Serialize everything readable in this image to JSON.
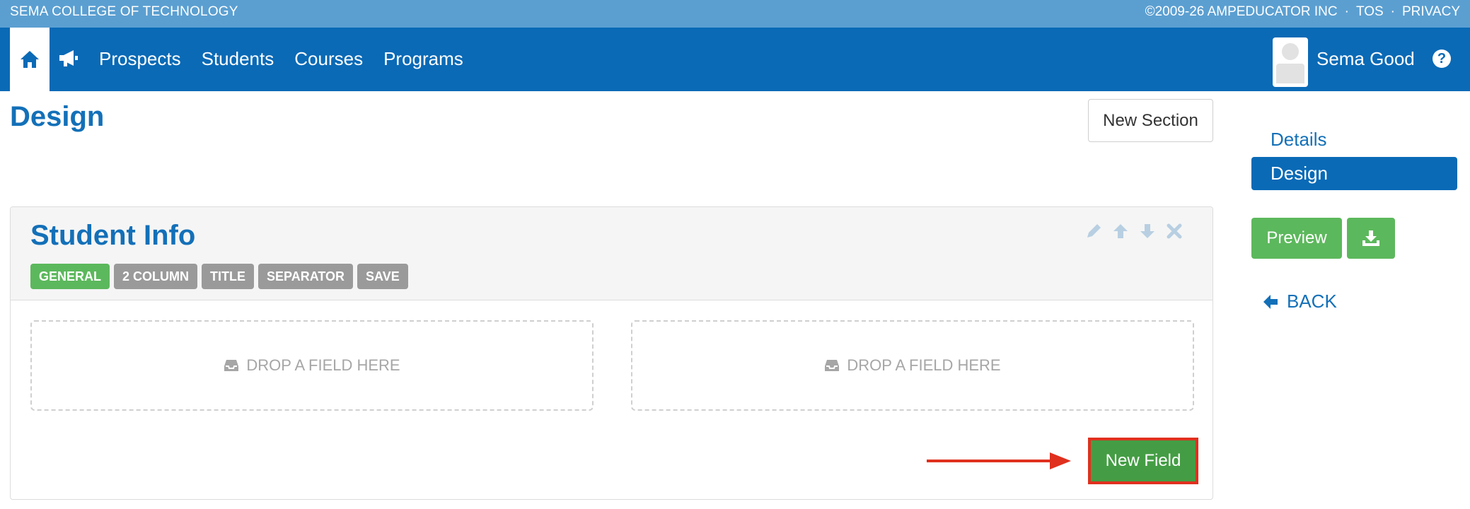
{
  "topstrip": {
    "school": "SEMA COLLEGE OF TECHNOLOGY",
    "copyright": "©2009-26 AMPEDUCATOR INC",
    "tos": "TOS",
    "privacy": "PRIVACY",
    "separator": "·"
  },
  "nav": {
    "home_icon": "home-icon",
    "announce_icon": "megaphone-icon",
    "links": [
      "Prospects",
      "Students",
      "Courses",
      "Programs"
    ],
    "user_name": "Sema Good",
    "help_icon": "?"
  },
  "page": {
    "title": "Design",
    "new_section_label": "New Section"
  },
  "section": {
    "title": "Student Info",
    "badges": [
      "GENERAL",
      "2 COLUMN",
      "TITLE",
      "SEPARATOR",
      "SAVE"
    ],
    "active_badge": "GENERAL",
    "tools": [
      "pencil-icon",
      "arrow-up-icon",
      "arrow-down-icon",
      "close-icon"
    ],
    "dropzones": [
      "DROP A FIELD HERE",
      "DROP A FIELD HERE"
    ],
    "new_field_label": "New Field"
  },
  "sidebar": {
    "details_label": "Details",
    "design_label": "Design",
    "preview_label": "Preview",
    "download_icon": "download-icon",
    "back_label": "BACK"
  },
  "colors": {
    "brand_blue": "#0a6ab6",
    "top_strip": "#5b9fd1",
    "success_green": "#5cb85c",
    "highlight_red": "#e0301e"
  }
}
